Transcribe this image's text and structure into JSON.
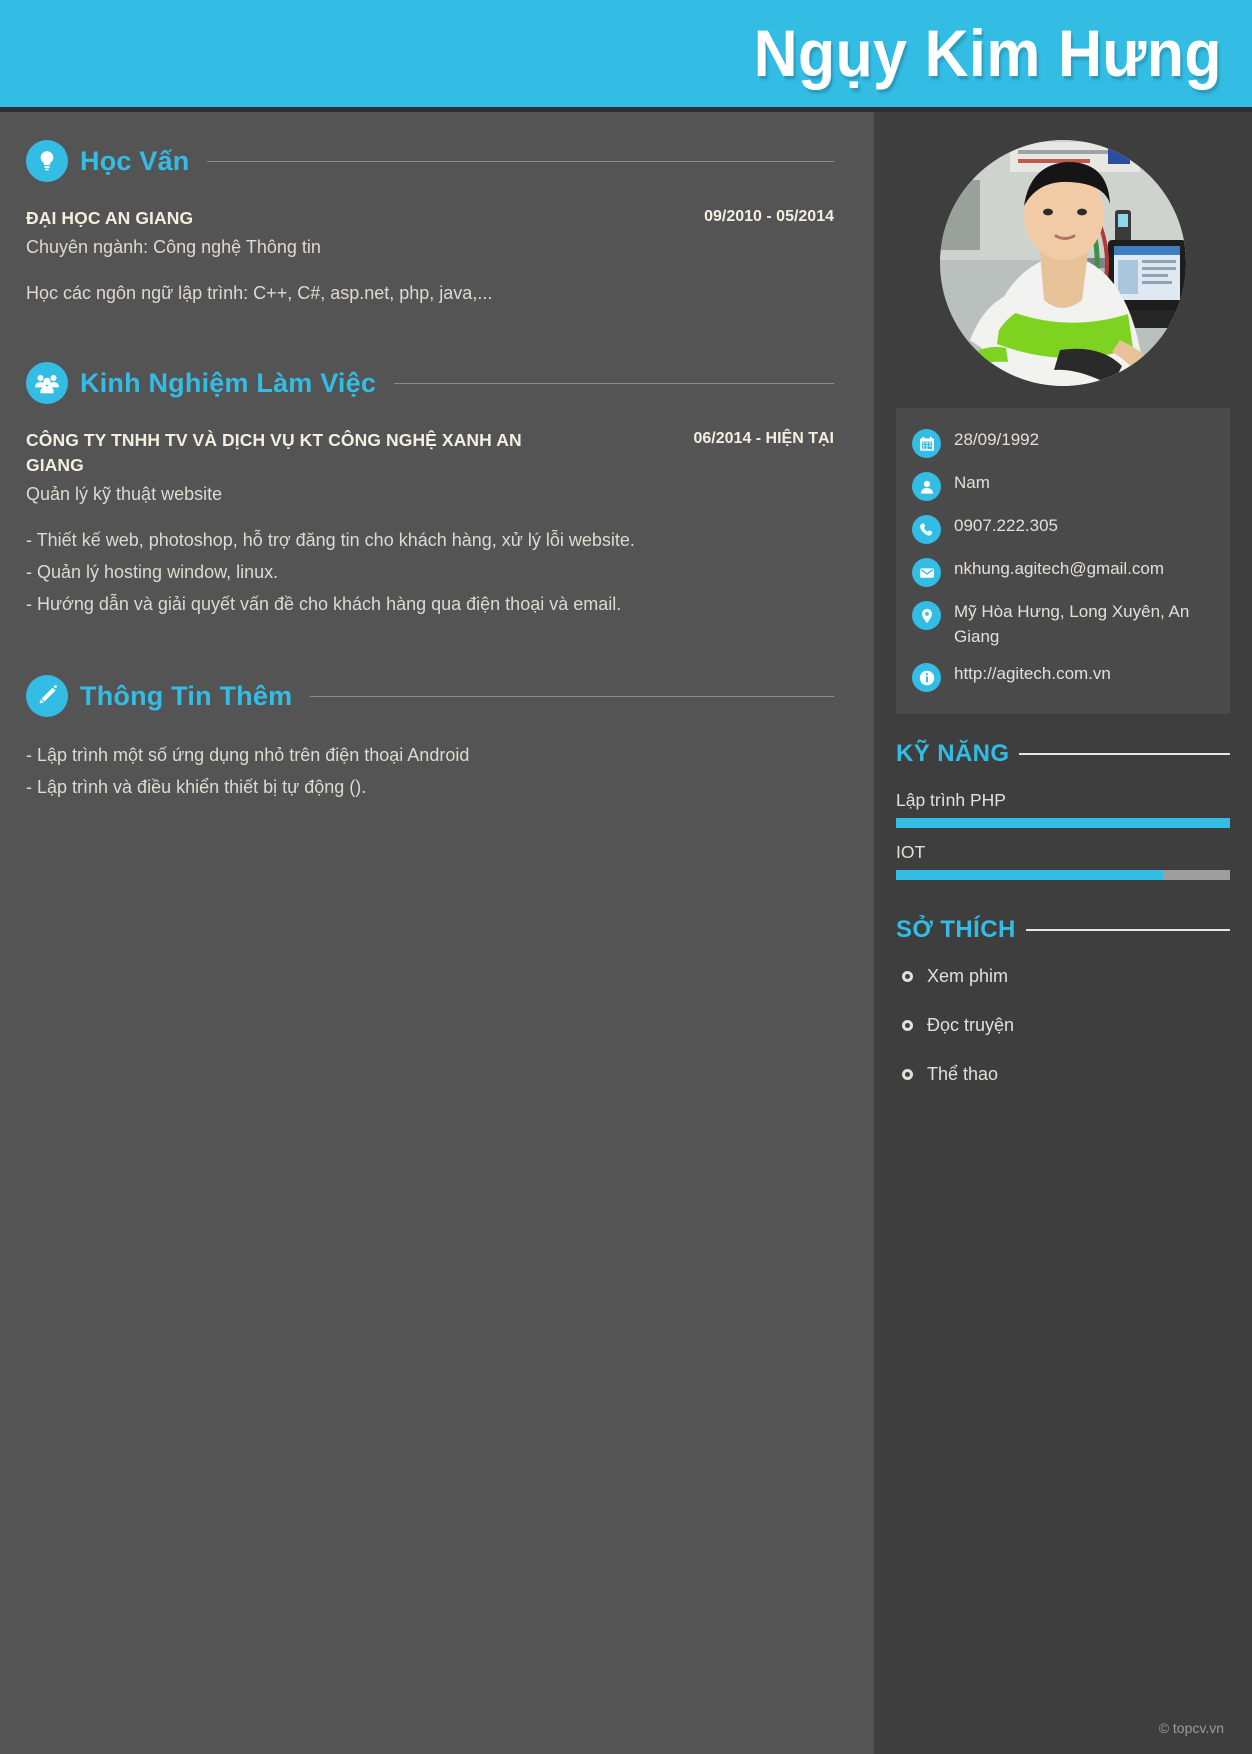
{
  "header": {
    "name": "Ngụy Kim Hưng",
    "accent_color": "#33bde4"
  },
  "main": {
    "sections": [
      {
        "id": "education",
        "title": "Học Vấn",
        "icon": "lightbulb-icon",
        "entries": [
          {
            "organization": "ĐẠI HỌC AN GIANG",
            "date": "09/2010 - 05/2014",
            "subtitle": "Chuyên ngành: Công nghệ Thông tin",
            "description": [
              "Học các ngôn ngữ lập trình: C++, C#, asp.net, php, java,..."
            ]
          }
        ]
      },
      {
        "id": "experience",
        "title": "Kinh Nghiệm Làm Việc",
        "icon": "people-group-icon",
        "entries": [
          {
            "organization": "CÔNG TY TNHH TV VÀ DỊCH VỤ KT CÔNG NGHỆ XANH AN GIANG",
            "date": "06/2014 - HIỆN TẠI",
            "subtitle": "Quản lý kỹ thuật website",
            "description": [
              "- Thiết kế web, photoshop, hỗ trợ đăng tin cho khách hàng, xử lý lỗi website.",
              "- Quản lý hosting window, linux.",
              "- Hướng dẫn và giải quyết vấn đề cho khách hàng qua điện thoại và email."
            ]
          }
        ]
      },
      {
        "id": "additional",
        "title": "Thông Tin Thêm",
        "icon": "pencil-icon",
        "entries": [
          {
            "organization": "",
            "date": "",
            "subtitle": "",
            "description": [
              "- Lập trình một số ứng dụng nhỏ trên điện thoại Android",
              "- Lập trình và điều khiển thiết bị tự động ()."
            ]
          }
        ]
      }
    ]
  },
  "sidebar": {
    "photo_alt": "profile-photo",
    "contact": [
      {
        "icon": "calendar-icon",
        "label": "28/09/1992"
      },
      {
        "icon": "person-icon",
        "label": "Nam"
      },
      {
        "icon": "phone-icon",
        "label": "0907.222.305"
      },
      {
        "icon": "envelope-icon",
        "label": "nkhung.agitech@gmail.com"
      },
      {
        "icon": "map-pin-icon",
        "label": "Mỹ Hòa Hưng, Long Xuyên, An Giang"
      },
      {
        "icon": "info-icon",
        "label": "http://agitech.com.vn"
      }
    ],
    "skills_title": "KỸ NĂNG",
    "skills": [
      {
        "name": "Lập trình PHP",
        "percent": 100
      },
      {
        "name": "IOT",
        "percent": 80
      }
    ],
    "hobbies_title": "SỞ THÍCH",
    "hobbies": [
      {
        "label": "Xem phim"
      },
      {
        "label": "Đọc truyện"
      },
      {
        "label": "Thể thao"
      }
    ]
  },
  "footer": {
    "watermark": "© topcv.vn"
  }
}
